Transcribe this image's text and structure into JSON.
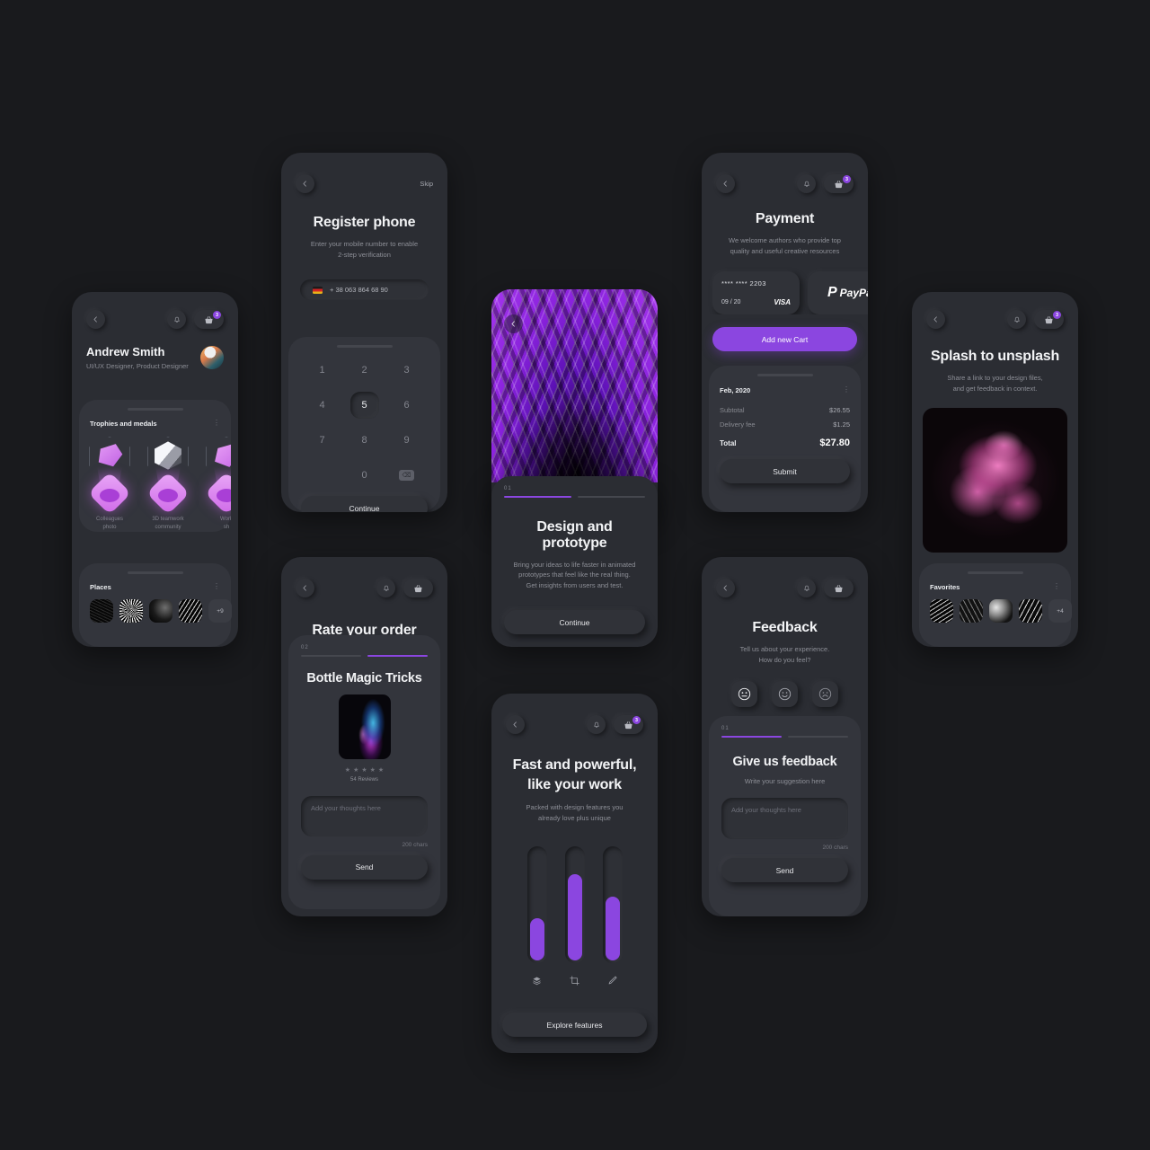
{
  "profile": {
    "name": "Andrew Smith",
    "role": "UI/UX Designer, Product Designer",
    "trophies_title": "Trophies and medals",
    "trophies": [
      {
        "label": "Colleagues\nphoto"
      },
      {
        "label": "3D teamwork\ncommunity"
      },
      {
        "label": "Work\nsh"
      }
    ],
    "places_title": "Places",
    "places_more": "+9"
  },
  "register": {
    "skip": "Skip",
    "title": "Register phone",
    "subtitle": "Enter your mobile number to enable\n2-step verification",
    "phone_value": "+ 38 063 864 68 90",
    "keys": [
      "1",
      "2",
      "3",
      "4",
      "5",
      "6",
      "7",
      "8",
      "9",
      "",
      "0",
      "del"
    ],
    "active_key": "5",
    "continue_label": "Continue"
  },
  "rate": {
    "title": "Rate your order",
    "step": "02",
    "product": "Bottle Magic Tricks",
    "rating": 5,
    "reviews": "54 Reviews",
    "placeholder": "Add your thoughts here",
    "chars": "200 chars",
    "send_label": "Send"
  },
  "design": {
    "step": "01",
    "title": "Design and prototype",
    "subtitle": "Bring your ideas to life faster in animated\nprototypes that feel like the real thing.\nGet insights from users and test.",
    "continue_label": "Continue"
  },
  "features": {
    "title": "Fast and powerful,\nlike your work",
    "subtitle": "Packed with design features you\nalready love plus unique",
    "sliders": [
      {
        "icon": "layers-icon",
        "value": 38
      },
      {
        "icon": "crop-icon",
        "value": 78
      },
      {
        "icon": "pen-icon",
        "value": 58
      }
    ],
    "explore_label": "Explore features"
  },
  "payment": {
    "title": "Payment",
    "subtitle": "We welcome authors who provide top\nquality and useful creative resources",
    "card_number": "**** **** 2203",
    "card_expiry": "09 / 20",
    "card_brand": "VISA",
    "paypal_label": "PayPal",
    "add_cart_label": "Add new Cart",
    "order_date": "Feb, 2020",
    "lines": [
      {
        "label": "Subtotal",
        "value": "$26.55"
      },
      {
        "label": "Delivery fee",
        "value": "$1.25"
      }
    ],
    "total_label": "Total",
    "total_value": "$27.80",
    "submit_label": "Submit"
  },
  "feedback": {
    "title": "Feedback",
    "subtitle": "Tell us about your experience.\nHow do you feel?",
    "moods": [
      "neutral-face-icon",
      "smiling-face-icon",
      "frowning-face-icon"
    ],
    "step": "01",
    "form_title": "Give us feedback",
    "form_subtitle": "Write your suggestion here",
    "placeholder": "Add your thoughts here",
    "chars": "200 chars",
    "send_label": "Send"
  },
  "splash": {
    "title": "Splash to unsplash",
    "subtitle": "Share a link to your design files,\nand get feedback in context.",
    "favorites_title": "Favorites",
    "favorites_more": "+4"
  },
  "colors": {
    "accent": "#8b46e0",
    "bg": "#191a1d",
    "card": "#2b2d33",
    "panel": "#33353c"
  }
}
